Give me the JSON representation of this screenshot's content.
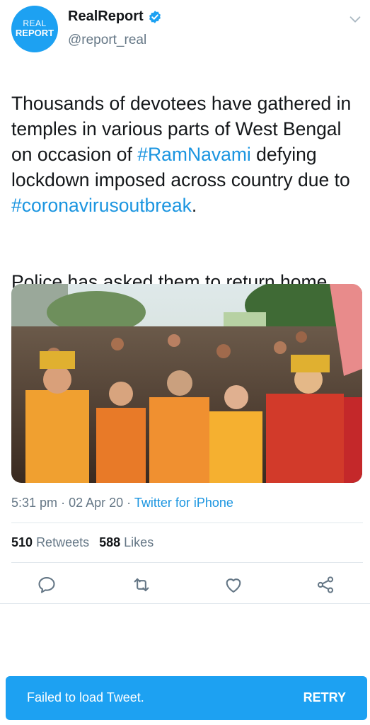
{
  "account": {
    "avatar_line1": "REAL",
    "avatar_line2": "REPORT",
    "display_name": "RealReport",
    "handle": "@report_real"
  },
  "icons": {
    "verified": "verified-badge-icon",
    "menu": "chevron-down-icon",
    "reply": "reply-icon",
    "retweet": "retweet-icon",
    "like": "heart-icon",
    "share": "share-icon"
  },
  "tweet": {
    "segments": [
      "Thousands of devotees have gathered in temples in various parts of West Bengal on occasion of ",
      "#RamNavami",
      " defying lockdown imposed across country due to ",
      "#coronavirusoutbreak",
      "."
    ],
    "paragraph2": "Police has asked them to return home immediately.",
    "time": "5:31 pm",
    "date": "02 Apr 20",
    "separator": "·",
    "source": "Twitter for iPhone"
  },
  "stats": {
    "retweets_count": "510",
    "retweets_label": "Retweets",
    "likes_count": "588",
    "likes_label": "Likes"
  },
  "toast": {
    "message": "Failed to load Tweet.",
    "action": "RETRY"
  },
  "colors": {
    "accent": "#1da1f2",
    "link": "#1b95e0",
    "secondary_text": "#657786",
    "primary_text": "#14171a"
  }
}
